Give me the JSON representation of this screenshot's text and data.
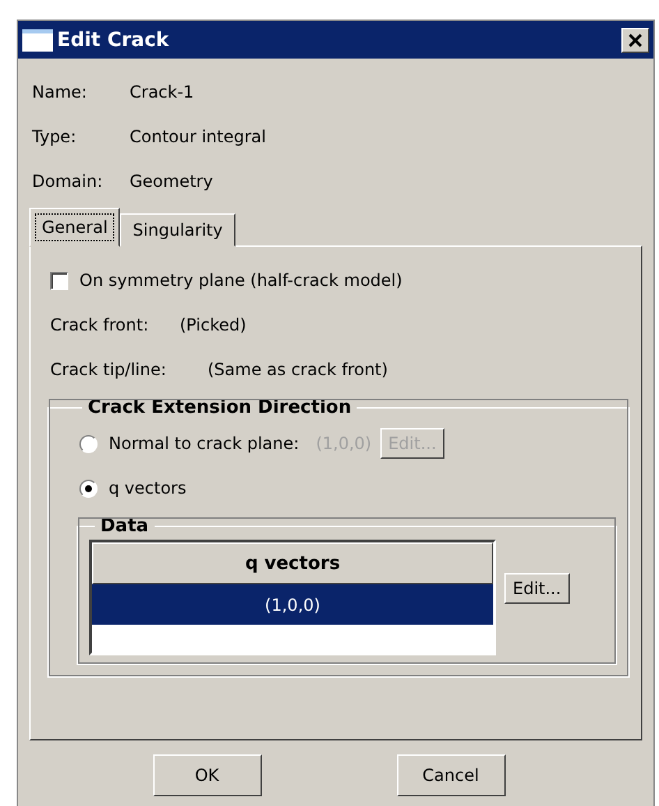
{
  "window": {
    "title": "Edit Crack"
  },
  "fields": [
    {
      "label": "Name:",
      "value": "Crack-1"
    },
    {
      "label": "Type:",
      "value": "Contour integral"
    },
    {
      "label": "Domain:",
      "value": "Geometry"
    }
  ],
  "tabs": [
    {
      "label": "General",
      "selected": true
    },
    {
      "label": "Singularity",
      "selected": false
    }
  ],
  "symmetry": {
    "label": "On symmetry plane (half-crack model)",
    "checked": false
  },
  "info": [
    {
      "label": "Crack front:",
      "value": "(Picked)"
    },
    {
      "label": "Crack tip/line:",
      "value": "(Same as crack front)"
    }
  ],
  "direction": {
    "title": "Crack Extension Direction",
    "options": [
      {
        "label": "Normal to crack plane:",
        "selected": false,
        "value": "(1,0,0)",
        "button": "Edit...",
        "disabled": true
      },
      {
        "label": "q vectors",
        "selected": true
      }
    ]
  },
  "data": {
    "title": "Data",
    "column": "q vectors",
    "rows": [
      {
        "value": "(1,0,0)",
        "selected": true
      }
    ],
    "button": "Edit..."
  },
  "buttons": [
    "OK",
    "Cancel"
  ]
}
